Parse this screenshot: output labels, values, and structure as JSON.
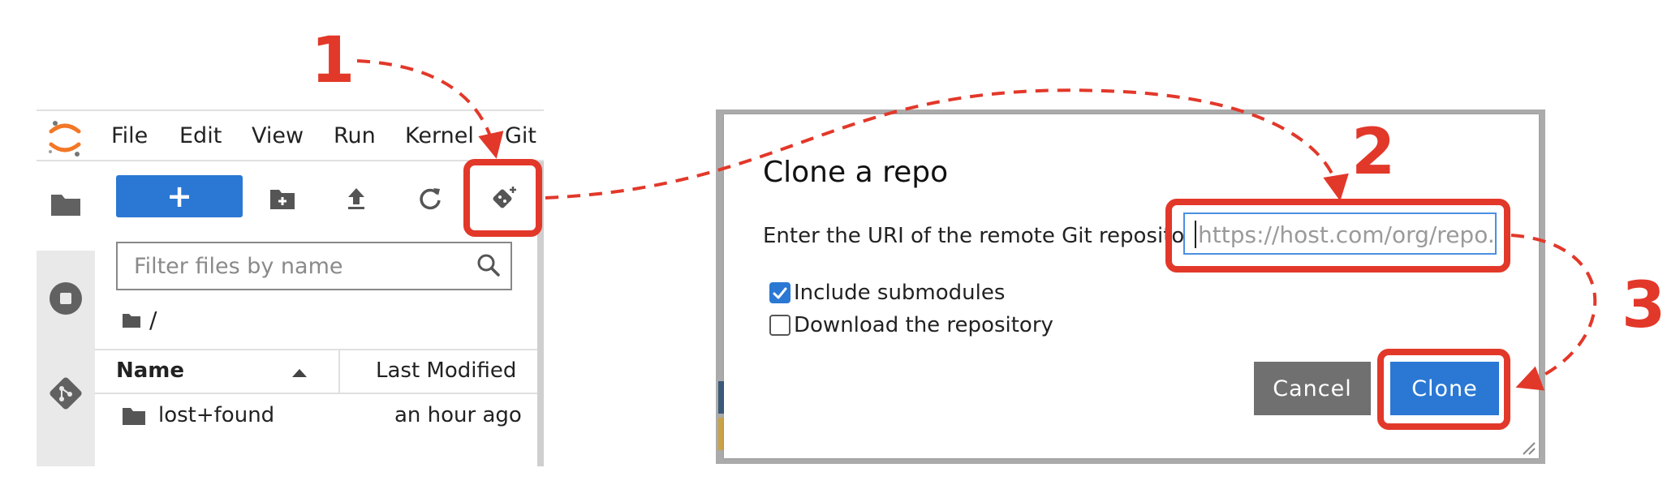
{
  "menubar": {
    "items": [
      {
        "label": "File"
      },
      {
        "label": "Edit"
      },
      {
        "label": "View"
      },
      {
        "label": "Run"
      },
      {
        "label": "Kernel"
      },
      {
        "label": "Git"
      }
    ]
  },
  "sidebar": {
    "icons": [
      "folder-icon",
      "stop-circle-icon",
      "git-icon"
    ]
  },
  "file_browser": {
    "new_button_label": "+",
    "toolbar_icons": [
      "new-folder-icon",
      "upload-icon",
      "refresh-icon",
      "git-clone-icon"
    ],
    "filter_placeholder": "Filter files by name",
    "breadcrumb": "/",
    "columns": {
      "name": "Name",
      "modified": "Last Modified"
    },
    "rows": [
      {
        "name": "lost+found",
        "modified": "an hour ago"
      }
    ]
  },
  "dialog": {
    "title": "Clone a repo",
    "prompt": "Enter the URI of the remote Git repository",
    "uri_placeholder": "https://host.com/org/repo.git",
    "checkboxes": [
      {
        "label": "Include submodules",
        "checked": true
      },
      {
        "label": "Download the repository",
        "checked": false
      }
    ],
    "cancel_label": "Cancel",
    "clone_label": "Clone"
  },
  "annotations": {
    "steps": [
      "1",
      "2",
      "3"
    ],
    "color": "#e2382a"
  },
  "colors": {
    "accent": "#2a78d4",
    "cancel": "#707070",
    "highlight": "#e2382a"
  }
}
